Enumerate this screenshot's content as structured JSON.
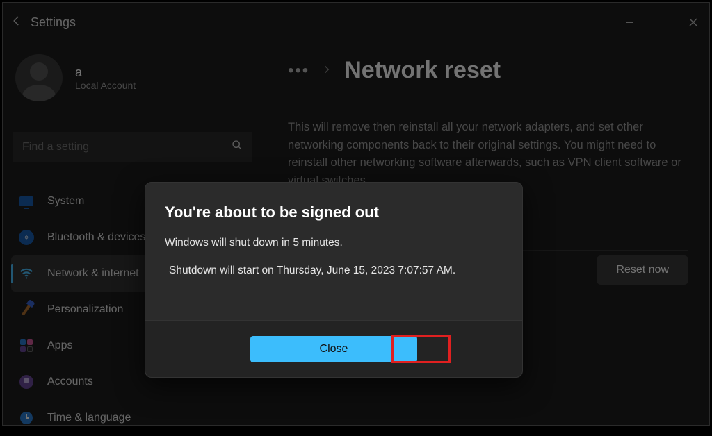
{
  "window": {
    "title": "Settings"
  },
  "profile": {
    "name": "a",
    "subtitle": "Local Account"
  },
  "search": {
    "placeholder": "Find a setting"
  },
  "nav": {
    "items": [
      {
        "label": "System",
        "icon": "monitor-icon"
      },
      {
        "label": "Bluetooth & devices",
        "icon": "bluetooth-icon"
      },
      {
        "label": "Network & internet",
        "icon": "wifi-icon",
        "active": true
      },
      {
        "label": "Personalization",
        "icon": "brush-icon"
      },
      {
        "label": "Apps",
        "icon": "apps-icon"
      },
      {
        "label": "Accounts",
        "icon": "account-icon"
      },
      {
        "label": "Time & language",
        "icon": "clock-icon"
      }
    ]
  },
  "breadcrumb": {
    "ellipsis": "•••",
    "title": "Network reset"
  },
  "page": {
    "description": "This will remove then reinstall all your network adapters, and set other networking components back to their original settings. You might need to reinstall other networking software afterwards, such as VPN client software or virtual switches.",
    "reset_button": "Reset now"
  },
  "dialog": {
    "title": "You're about to be signed out",
    "line1": "Windows will shut down in 5 minutes.",
    "line2": "Shutdown will start on Thursday, June 15, 2023 7:07:57 AM.",
    "close": "Close"
  },
  "annotation": {
    "close_highlight": true
  }
}
